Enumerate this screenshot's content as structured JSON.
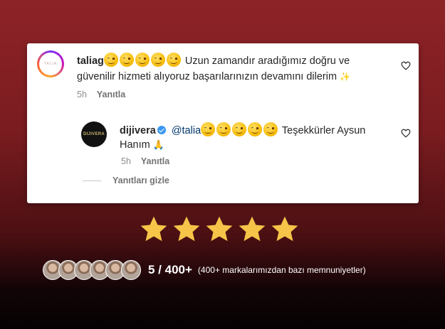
{
  "comment": {
    "username": "taliag",
    "avatar_text": "TALIA",
    "emoji_count": 5,
    "text": "Uzun zamandır aradığımız doğru ve güvenilir hizmeti alıyoruz başarılarınızın devamını dilerim",
    "time": "5h",
    "reply_label": "Yanıtla"
  },
  "reply": {
    "username": "dijivera",
    "avatar_text": "DIJIVERA",
    "mention": "@talia",
    "emoji_count": 5,
    "text": "Teşekkürler Aysun Hanım",
    "time": "5h",
    "reply_label": "Yanıtla"
  },
  "hide_replies_label": "Yanıtları gizle",
  "rating": {
    "stars": 5,
    "score": "5 / 400+",
    "caption": "(400+ markalarımızdan bazı memnuniyetler)",
    "faces_count": 6
  },
  "colors": {
    "background_top": "#8d2327",
    "background_bottom": "#050102",
    "star": "#f6c448",
    "verified": "#3897f0"
  }
}
